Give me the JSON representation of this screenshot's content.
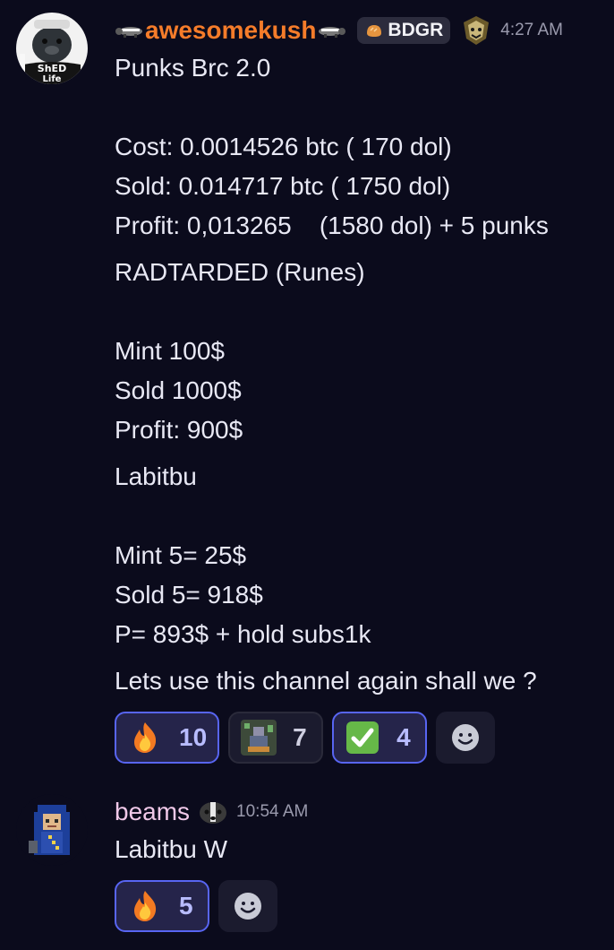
{
  "messages": [
    {
      "username": "awesomekush",
      "role_tag": "BDGR",
      "timestamp": "4:27 AM",
      "lines": [
        "Punks Brc 2.0",
        "",
        "Cost: 0.0014526 btc ( 170 dol)",
        "Sold: 0.014717 btc ( 1750 dol)",
        "Profit: 0,013265    (1580 dol) + 5 punks",
        "RADTARDED (Runes)",
        "",
        "Mint 100$",
        "Sold 1000$",
        "Profit: 900$",
        "Labitbu",
        "",
        "Mint 5= 25$",
        "Sold 5= 918$",
        "P= 893$ + hold subs1k",
        "Lets use this channel again shall we ?"
      ],
      "reactions": [
        {
          "emoji": "fire-icon",
          "count": "10",
          "active": true
        },
        {
          "emoji": "custom-emoji",
          "count": "7",
          "active": false
        },
        {
          "emoji": "check-mark-icon",
          "count": "4",
          "active": true
        }
      ]
    },
    {
      "username": "beams",
      "timestamp": "10:54 AM",
      "lines": [
        "Labitbu W"
      ],
      "reactions": [
        {
          "emoji": "fire-icon",
          "count": "5",
          "active": true
        }
      ]
    }
  ],
  "colors": {
    "background": "#0b0b1c",
    "username_orange": "#f57c2a",
    "username_pink": "#f0c8e8",
    "reaction_active_border": "#5865f2"
  },
  "avatar_texts": {
    "shed_life": "ShED Life"
  }
}
